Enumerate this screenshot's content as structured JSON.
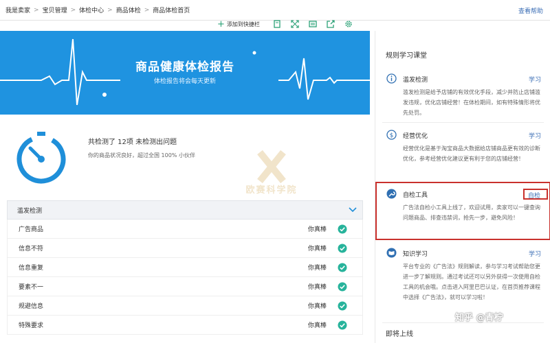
{
  "breadcrumb": [
    "我是卖家",
    "宝贝管理",
    "体检中心",
    "商品体检",
    "商品体检首页"
  ],
  "breadcrumb_sep": ">",
  "help_link": "查看帮助",
  "toolbar": {
    "add_label": "添加到快捷栏",
    "icons": [
      "book-icon",
      "expand-icon",
      "image-icon",
      "share-icon",
      "settings-icon"
    ]
  },
  "banner": {
    "title": "商品健康体检报告",
    "subtitle": "体检报告将会每天更新",
    "bg_color": "#1f93e0"
  },
  "summary": {
    "title": "共检测了 12项 未检测出问题",
    "desc": "你的商品状况良好，超过全国 100% 小伙伴"
  },
  "watermark": {
    "text": "欧赛科学院"
  },
  "check_panel": {
    "header": "滥发检测",
    "rows": [
      {
        "label": "广告商品",
        "status": "你真棒"
      },
      {
        "label": "信息不符",
        "status": "你真棒"
      },
      {
        "label": "信息重复",
        "status": "你真棒"
      },
      {
        "label": "要素不一",
        "status": "你真棒"
      },
      {
        "label": "规避信息",
        "status": "你真棒"
      },
      {
        "label": "特殊要求",
        "status": "你真棒"
      }
    ],
    "check_color": "#27b39b"
  },
  "right_panel": {
    "title": "规则学习课堂",
    "rules": [
      {
        "name": "滥发检测",
        "link": "学习",
        "desc": "滥发检测是给予店铺的有效优化手段，减少并防止店铺滥发违规，优化店铺经营！在体检期间，如有特殊情形将优先处罚。",
        "icon": "info-icon"
      },
      {
        "name": "经营优化",
        "link": "学习",
        "desc": "经营优化是基于淘宝商品大数据给店铺商品更有效的诊断优化，参考经营优化建议更有利于您的店铺经营！",
        "icon": "dollar-icon"
      },
      {
        "name": "自检工具",
        "link": "自检",
        "desc": "广告法自检小工具上线了，欢迎试用，卖家可以一键查询问题商品、排查违禁词，抢先一步，避免风险！",
        "icon": "wrench-icon"
      },
      {
        "name": "知识学习",
        "link": "学习",
        "desc": "平台专业的《广告法》规则解读，参与学习考试帮助您更进一步了解规则。通过考试还可以另外获得一次使用自检工具的机会哦。点击进入阿里巴巴认证，在首页推荐课程中选择《广告法》，就可以学习啦！",
        "icon": "book-open-icon"
      }
    ],
    "upcoming": "即将上线",
    "highlight_color": "#c9302c"
  },
  "brand_mark": "知乎 @青柠"
}
